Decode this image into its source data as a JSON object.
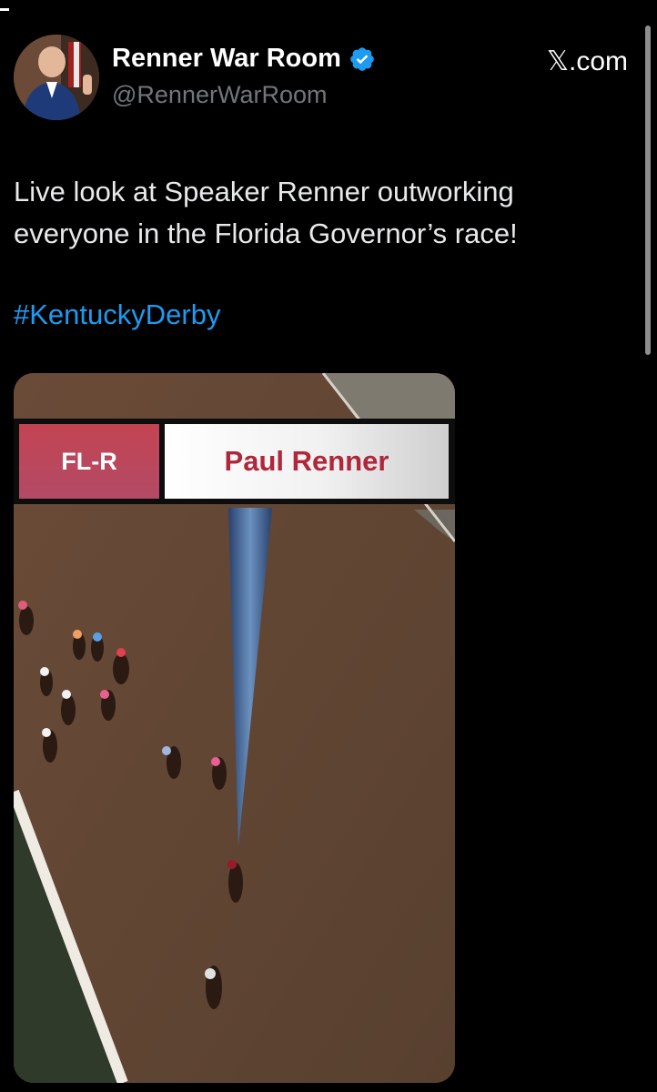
{
  "account": {
    "display_name": "Renner War Room",
    "handle": "@RennerWarRoom",
    "verified_icon": "verified-badge-icon",
    "avatar_icon": "profile-photo"
  },
  "source_label": "𝕏.com",
  "tweet": {
    "line1": "Live look at Speaker Renner outworking",
    "line2": "everyone in the Florida Governor’s race!",
    "hashtag": "#KentuckyDerby"
  },
  "video": {
    "lower_third": {
      "party": "FL-R",
      "name": "Paul Renner"
    }
  },
  "colors": {
    "background": "#000000",
    "hashtag": "#1d9bf0",
    "verified": "#1d9bf0",
    "party_box": "#c34452",
    "name_text": "#b0263a"
  }
}
